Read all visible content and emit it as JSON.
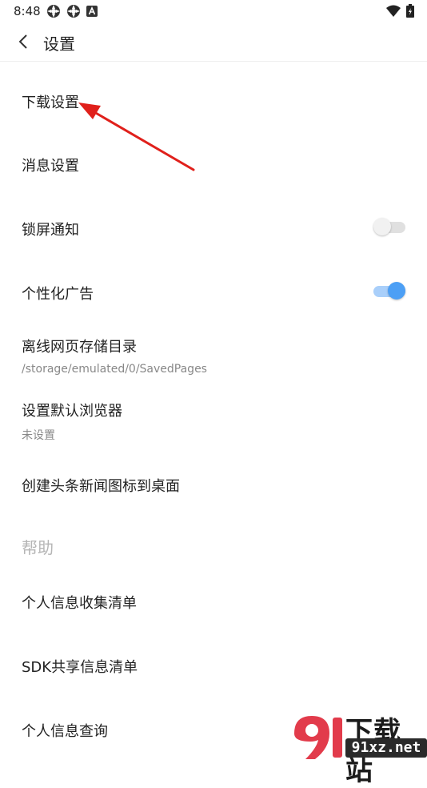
{
  "status_bar": {
    "time": "8:48"
  },
  "header": {
    "title": "设置"
  },
  "items": [
    {
      "label": "下载设置"
    },
    {
      "label": "消息设置"
    },
    {
      "label": "锁屏通知",
      "toggle_on": false
    },
    {
      "label": "个性化广告",
      "toggle_on": true
    },
    {
      "label": "离线网页存储目录",
      "sub": "/storage/emulated/0/SavedPages"
    },
    {
      "label": "设置默认浏览器",
      "sub": "未设置"
    },
    {
      "label": "创建头条新闻图标到桌面"
    }
  ],
  "help_section": {
    "title": "帮助"
  },
  "help_items": [
    {
      "label": "个人信息收集清单"
    },
    {
      "label": "SDK共享信息清单"
    },
    {
      "label": "个人信息查询"
    }
  ],
  "watermark": {
    "brand": "下载站",
    "url": "91xz.net"
  },
  "colors": {
    "accent": "#4c9ff5",
    "arrow": "#e0201b",
    "toggle_off": "#e0e0e0"
  }
}
